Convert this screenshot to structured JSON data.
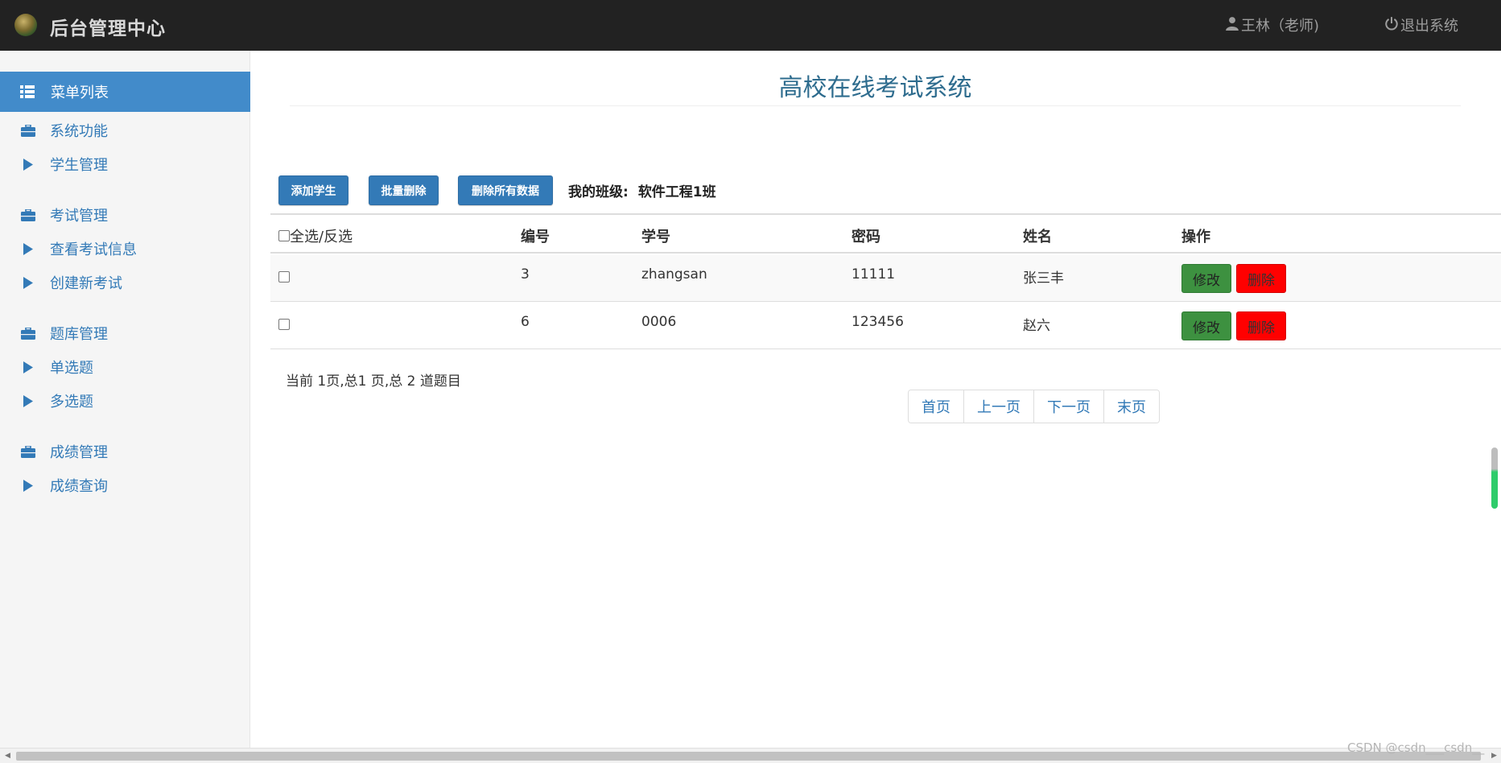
{
  "header": {
    "brand_title": "后台管理中心",
    "user_label": "王林（老师)",
    "logout_label": "退出系统"
  },
  "sidebar": {
    "active_label": "菜单列表",
    "items": [
      {
        "label": "系统功能",
        "icon": "briefcase-icon"
      },
      {
        "label": "学生管理",
        "icon": "triangle-right-icon"
      },
      {
        "label": "考试管理",
        "icon": "briefcase-icon"
      },
      {
        "label": "查看考试信息",
        "icon": "triangle-right-icon"
      },
      {
        "label": "创建新考试",
        "icon": "triangle-right-icon"
      },
      {
        "label": "题库管理",
        "icon": "briefcase-icon"
      },
      {
        "label": "单选题",
        "icon": "triangle-right-icon"
      },
      {
        "label": "多选题",
        "icon": "triangle-right-icon"
      },
      {
        "label": "成绩管理",
        "icon": "briefcase-icon"
      },
      {
        "label": "成绩查询",
        "icon": "triangle-right-icon"
      }
    ]
  },
  "main": {
    "title": "高校在线考试系统",
    "toolbar": {
      "add_label": "添加学生",
      "batch_delete_label": "批量删除",
      "delete_all_label": "删除所有数据",
      "class_prefix": "我的班级:",
      "class_name": "软件工程1班"
    },
    "table": {
      "headers": {
        "select": "全选/反选",
        "id": "编号",
        "student_no": "学号",
        "password": "密码",
        "name": "姓名",
        "actions": "操作"
      },
      "rows": [
        {
          "id": "3",
          "student_no": "zhangsan",
          "password": "11111",
          "name": "张三丰",
          "edit": "修改",
          "delete": "删除"
        },
        {
          "id": "6",
          "student_no": "0006",
          "password": "123456",
          "name": "赵六",
          "edit": "修改",
          "delete": "删除"
        }
      ]
    },
    "page_info": "当前 1页,总1 页,总 2 道题目",
    "pager": {
      "first": "首页",
      "prev": "上一页",
      "next": "下一页",
      "last": "末页"
    }
  },
  "watermark": "CSDN @csdn___csdn__",
  "colors": {
    "navbar": "#222222",
    "primary": "#337ab7",
    "sidebar_active": "#428bca",
    "edit_button": "#3d9140",
    "delete_button": "#ff0000"
  }
}
